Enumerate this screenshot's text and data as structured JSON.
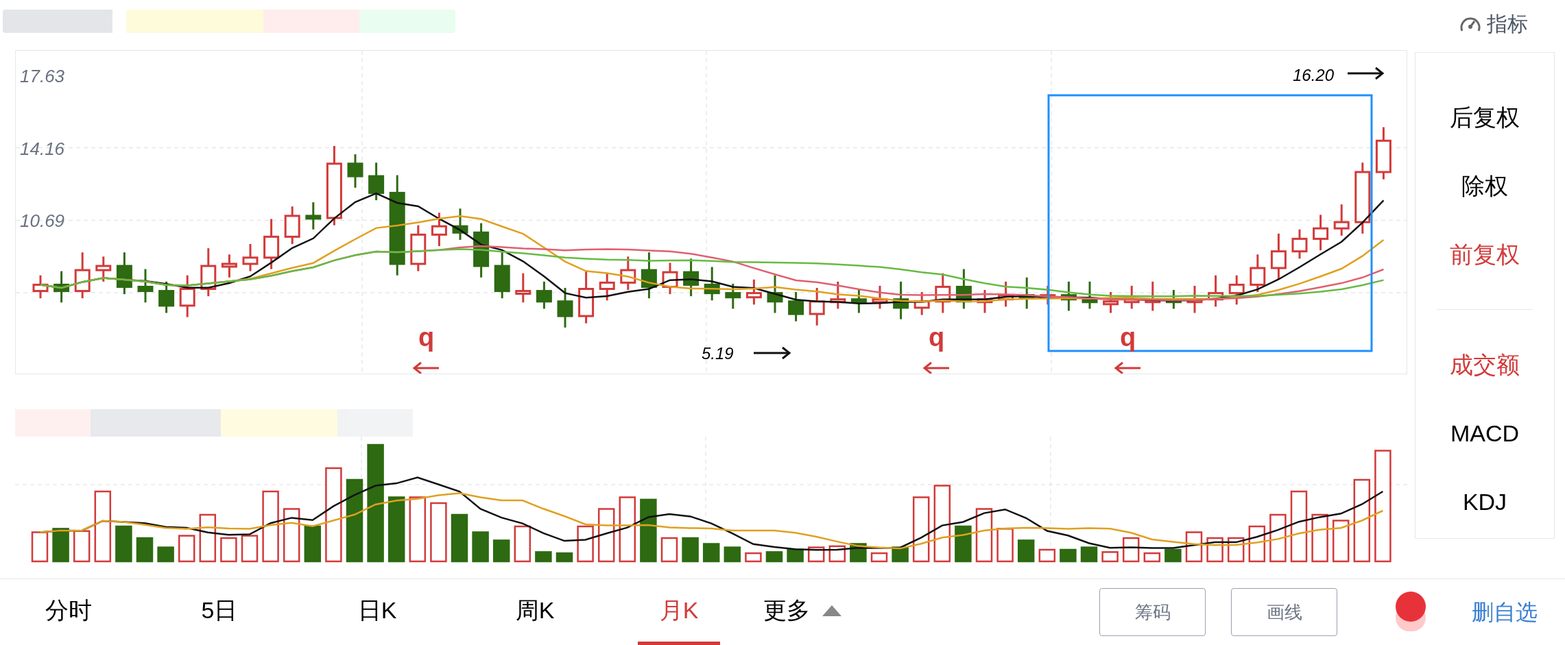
{
  "indicator_button": {
    "label": "指标"
  },
  "price_chart": {
    "axis_labels": [
      "17.63",
      "14.16",
      "10.69"
    ],
    "high_marker": {
      "text": "16.20"
    },
    "low_marker": {
      "text": "5.19"
    },
    "event_marks": [
      {
        "text": "q"
      },
      {
        "text": "q"
      },
      {
        "text": "q"
      }
    ]
  },
  "side_menu": {
    "adjust_items": [
      {
        "label": "后复权",
        "selected": false
      },
      {
        "label": "除权",
        "selected": false
      },
      {
        "label": "前复权",
        "selected": true
      }
    ],
    "indicator_items": [
      {
        "label": "成交额",
        "selected": true
      },
      {
        "label": "MACD",
        "selected": false
      },
      {
        "label": "KDJ",
        "selected": false
      }
    ]
  },
  "tabs": [
    {
      "label": "分时",
      "selected": false
    },
    {
      "label": "5日",
      "selected": false
    },
    {
      "label": "日K",
      "selected": false
    },
    {
      "label": "周K",
      "selected": false
    },
    {
      "label": "月K",
      "selected": true
    },
    {
      "label": "更多",
      "selected": false
    }
  ],
  "buttons": [
    "筹码",
    "画线"
  ],
  "watchlist_link": "删自选"
}
